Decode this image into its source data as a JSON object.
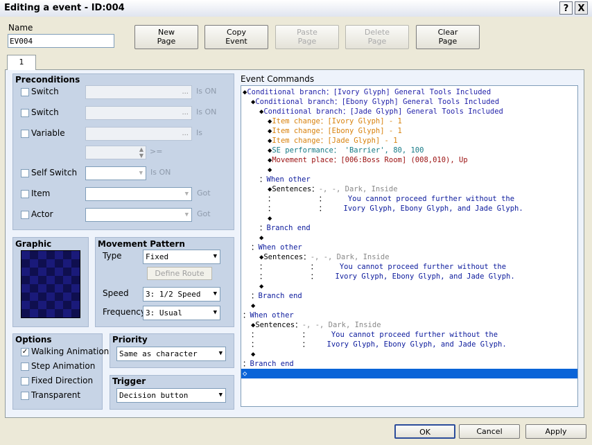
{
  "window": {
    "title": "Editing a event - ID:004",
    "help_glyph": "?",
    "close_glyph": "X"
  },
  "name": {
    "label": "Name",
    "value": "EV004"
  },
  "toolbar": {
    "new_page": [
      "New",
      "Page"
    ],
    "copy_event": [
      "Copy",
      "Event"
    ],
    "paste_page": [
      "Paste",
      "Page"
    ],
    "delete_page": [
      "Delete",
      "Page"
    ],
    "clear_page": [
      "Clear",
      "Page"
    ]
  },
  "tabs": [
    {
      "label": "1"
    }
  ],
  "preconditions": {
    "title": "Preconditions",
    "switch1": {
      "label": "Switch",
      "suffix": "Is ON",
      "field": "..."
    },
    "switch2": {
      "label": "Switch",
      "suffix": "Is ON",
      "field": "..."
    },
    "variable": {
      "label": "Variable",
      "suffix": "Is",
      "field": "...",
      "compare": ">="
    },
    "self_switch": {
      "label": "Self Switch",
      "suffix": "Is ON"
    },
    "item": {
      "label": "Item",
      "suffix": "Got"
    },
    "actor": {
      "label": "Actor",
      "suffix": "Got"
    }
  },
  "graphic": {
    "title": "Graphic"
  },
  "movement": {
    "title": "Movement Pattern",
    "type_label": "Type",
    "type_value": "Fixed",
    "define_route": "Define Route",
    "speed_label": "Speed",
    "speed_value": "3: 1/2 Speed",
    "frequency_label": "Frequency",
    "frequency_value": "3: Usual"
  },
  "options": {
    "title": "Options",
    "walking": {
      "label": "Walking Animation",
      "checked": true
    },
    "step": {
      "label": "Step Animation",
      "checked": false
    },
    "fixed_dir": {
      "label": "Fixed Direction",
      "checked": false
    },
    "transparent": {
      "label": "Transparent",
      "checked": false
    }
  },
  "priority": {
    "title": "Priority",
    "value": "Same as character"
  },
  "trigger": {
    "title": "Trigger",
    "value": "Decision button"
  },
  "event_commands": {
    "title": "Event Commands",
    "lines": [
      {
        "indent": 0,
        "bullet": "◆",
        "cls": "c-blue",
        "text": "Conditional branch：[Ivory Glyph] General Tools Included"
      },
      {
        "indent": 1,
        "bullet": "◆",
        "cls": "c-blue",
        "text": "Conditional branch：[Ebony Glyph] General Tools Included"
      },
      {
        "indent": 2,
        "bullet": "◆",
        "cls": "c-blue",
        "text": "Conditional branch：[Jade Glyph] General Tools Included"
      },
      {
        "indent": 3,
        "bullet": "◆",
        "cls": "c-orange",
        "text": "Item change：[Ivory Glyph] - 1"
      },
      {
        "indent": 3,
        "bullet": "◆",
        "cls": "c-orange",
        "text": "Item change：[Ebony Glyph] - 1"
      },
      {
        "indent": 3,
        "bullet": "◆",
        "cls": "c-orange",
        "text": "Item change：[Jade Glyph] - 1"
      },
      {
        "indent": 3,
        "bullet": "◆",
        "cls": "c-teal",
        "text": "SE performance： 'Barrier', 80, 100"
      },
      {
        "indent": 3,
        "bullet": "◆",
        "cls": "c-red",
        "text": "Movement place：[006:Boss Room] (008,010), Up"
      },
      {
        "indent": 3,
        "bullet": "◆",
        "cls": "",
        "text": ""
      },
      {
        "indent": 2,
        "bullet": "：",
        "cls": "c-dblue",
        "text": "When other"
      },
      {
        "indent": 3,
        "bullet": "◆",
        "cls": "",
        "text": "Sentences：",
        "gray": "-, -, Dark, Inside"
      },
      {
        "indent": 3,
        "bullet": "：",
        "cls": "",
        "text": "          ：",
        "blue": "     You cannot proceed further without the"
      },
      {
        "indent": 3,
        "bullet": "：",
        "cls": "",
        "text": "          ：",
        "blue": "    Ivory Glyph, Ebony Glyph, and Jade Glyph."
      },
      {
        "indent": 3,
        "bullet": "◆",
        "cls": "",
        "text": ""
      },
      {
        "indent": 2,
        "bullet": "：",
        "cls": "c-dblue",
        "text": "Branch end"
      },
      {
        "indent": 2,
        "bullet": "◆",
        "cls": "",
        "text": ""
      },
      {
        "indent": 1,
        "bullet": "：",
        "cls": "c-dblue",
        "text": "When other"
      },
      {
        "indent": 2,
        "bullet": "◆",
        "cls": "",
        "text": "Sentences：",
        "gray": "-, -, Dark, Inside"
      },
      {
        "indent": 2,
        "bullet": "：",
        "cls": "",
        "text": "          ：",
        "blue": "     You cannot proceed further without the"
      },
      {
        "indent": 2,
        "bullet": "：",
        "cls": "",
        "text": "          ：",
        "blue": "    Ivory Glyph, Ebony Glyph, and Jade Glyph."
      },
      {
        "indent": 2,
        "bullet": "◆",
        "cls": "",
        "text": ""
      },
      {
        "indent": 1,
        "bullet": "：",
        "cls": "c-dblue",
        "text": "Branch end"
      },
      {
        "indent": 1,
        "bullet": "◆",
        "cls": "",
        "text": ""
      },
      {
        "indent": 0,
        "bullet": "：",
        "cls": "c-dblue",
        "text": "When other"
      },
      {
        "indent": 1,
        "bullet": "◆",
        "cls": "",
        "text": "Sentences：",
        "gray": "-, -, Dark, Inside"
      },
      {
        "indent": 1,
        "bullet": "：",
        "cls": "",
        "text": "          ：",
        "blue": "     You cannot proceed further without the"
      },
      {
        "indent": 1,
        "bullet": "：",
        "cls": "",
        "text": "          ：",
        "blue": "    Ivory Glyph, Ebony Glyph, and Jade Glyph."
      },
      {
        "indent": 1,
        "bullet": "◆",
        "cls": "",
        "text": ""
      },
      {
        "indent": 0,
        "bullet": "：",
        "cls": "c-dblue",
        "text": "Branch end"
      },
      {
        "indent": 0,
        "bullet": "◇",
        "cls": "",
        "text": "",
        "selected": true
      }
    ]
  },
  "footer": {
    "ok": "OK",
    "cancel": "Cancel",
    "apply": "Apply"
  }
}
